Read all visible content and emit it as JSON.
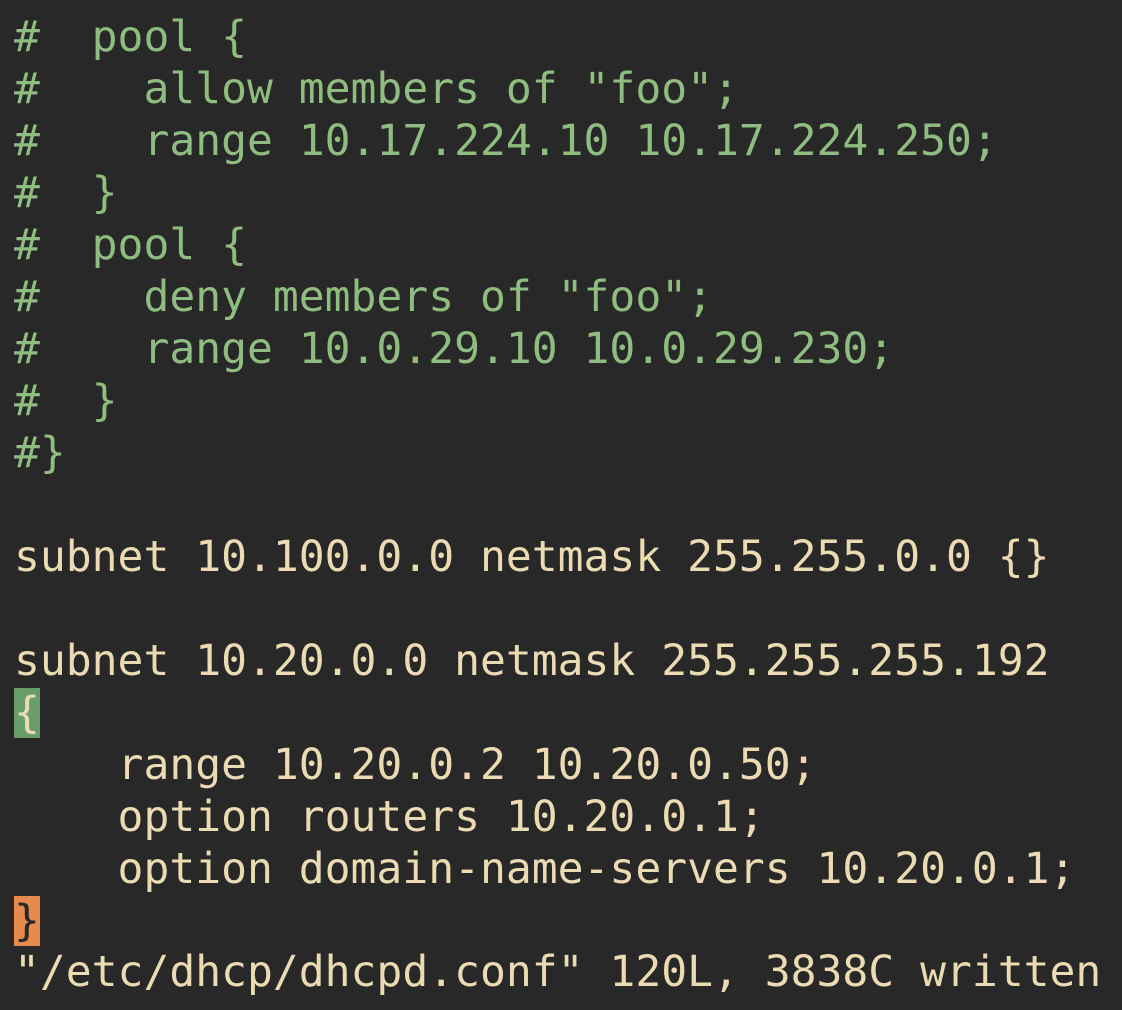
{
  "buffer": {
    "lines": [
      {
        "text": "#  pool {",
        "kind": "comment"
      },
      {
        "text": "#    allow members of \"foo\";",
        "kind": "comment"
      },
      {
        "text": "#    range 10.17.224.10 10.17.224.250;",
        "kind": "comment"
      },
      {
        "text": "#  }",
        "kind": "comment"
      },
      {
        "text": "#  pool {",
        "kind": "comment"
      },
      {
        "text": "#    deny members of \"foo\";",
        "kind": "comment"
      },
      {
        "text": "#    range 10.0.29.10 10.0.29.230;",
        "kind": "comment"
      },
      {
        "text": "#  }",
        "kind": "comment"
      },
      {
        "text": "#}",
        "kind": "comment"
      },
      {
        "text": "",
        "kind": "empty"
      },
      {
        "text": "subnet 10.100.0.0 netmask 255.255.0.0 {}",
        "kind": "code"
      },
      {
        "text": "",
        "kind": "empty"
      },
      {
        "text": "subnet 10.20.0.0 netmask 255.255.255.192",
        "kind": "code"
      },
      {
        "text": "{",
        "kind": "match-brace"
      },
      {
        "text": "    range 10.20.0.2 10.20.0.50;",
        "kind": "code"
      },
      {
        "text": "    option routers 10.20.0.1;",
        "kind": "code"
      },
      {
        "text": "    option domain-name-servers 10.20.0.1;",
        "kind": "code"
      },
      {
        "text": "}",
        "kind": "cursor-brace"
      }
    ]
  },
  "statusline": {
    "message": "\"/etc/dhcp/dhcpd.conf\" 120L, 3838C written"
  },
  "colors": {
    "background": "#282828",
    "foreground": "#ebdbb2",
    "comment": "#8fbc7f",
    "match_highlight": "#689d6a",
    "cursor": "#e78a4e"
  }
}
